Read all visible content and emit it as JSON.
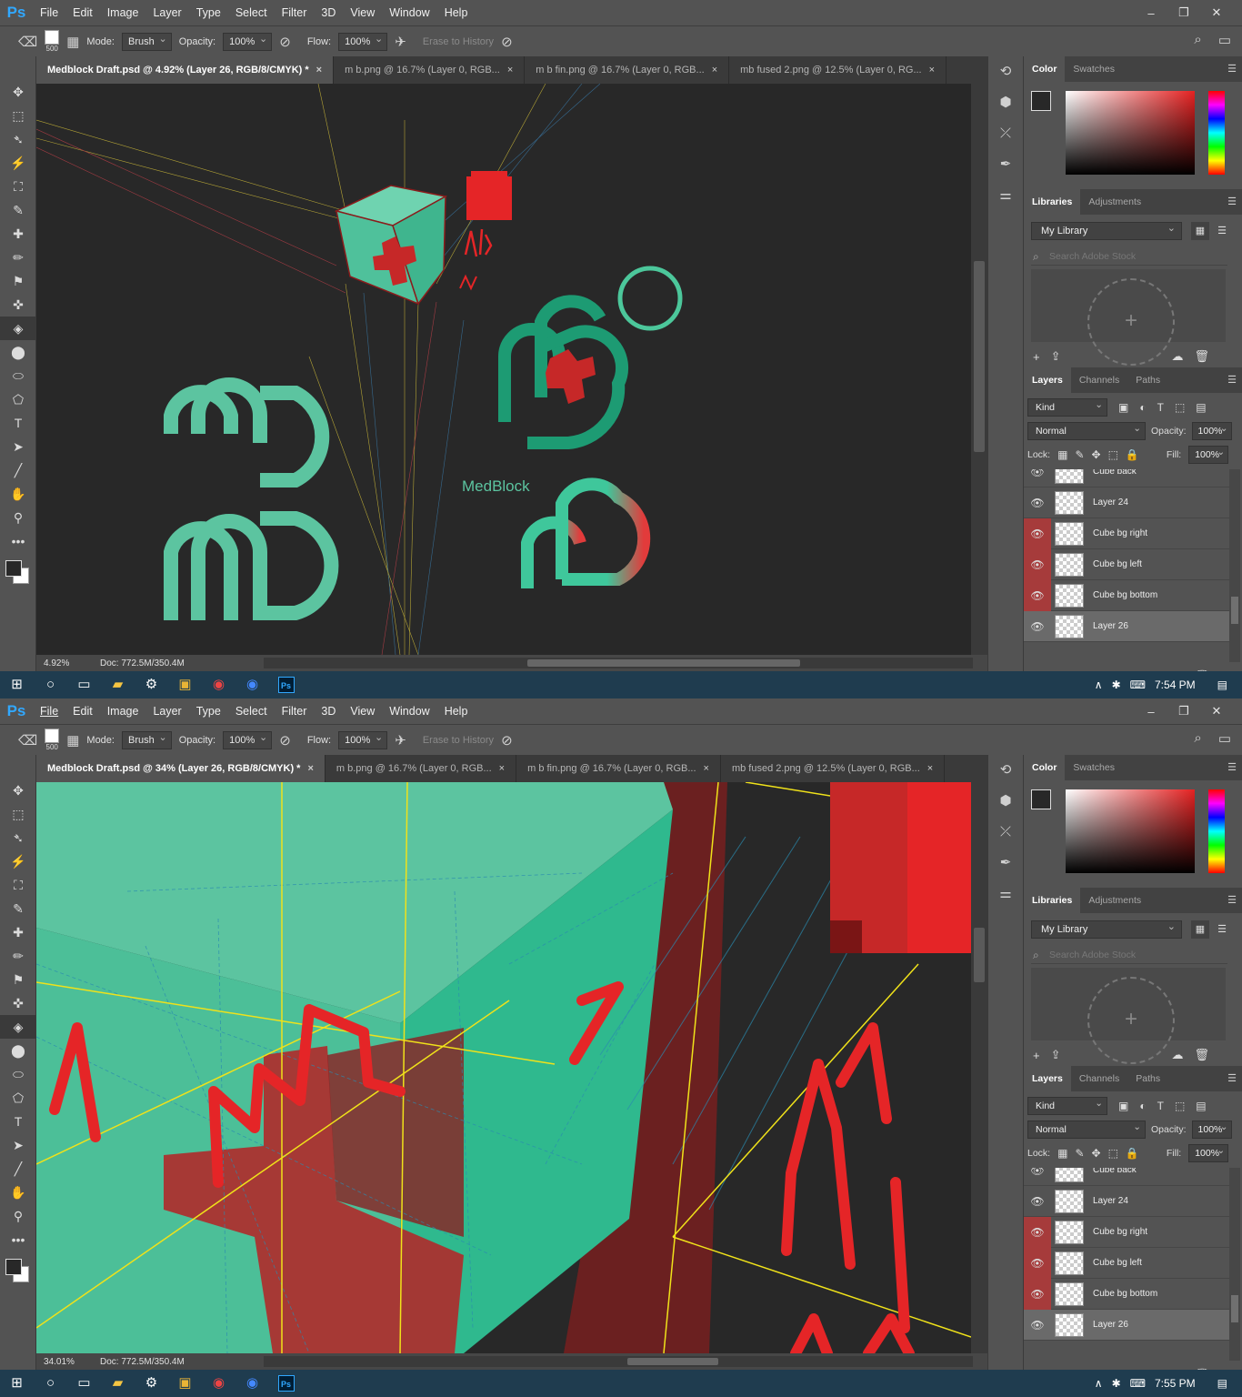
{
  "app": {
    "logo": "Ps"
  },
  "menu": [
    "File",
    "Edit",
    "Image",
    "Layer",
    "Type",
    "Select",
    "Filter",
    "3D",
    "View",
    "Window",
    "Help"
  ],
  "window_controls": [
    "–",
    "❐",
    "✕"
  ],
  "options": {
    "brush_size": "500",
    "mode_label": "Mode:",
    "mode_value": "Brush",
    "opacity_label": "Opacity:",
    "opacity_value": "100%",
    "flow_label": "Flow:",
    "flow_value": "100%",
    "erase_history": "Erase to History"
  },
  "tools": [
    "✥",
    "⬚",
    "➴",
    "⚡",
    "⛶",
    "✎",
    "✚",
    "✏",
    "⚑",
    "✜",
    "◈",
    "⬤",
    "⬭",
    "⬠",
    "T",
    "➤",
    "╱",
    "✋",
    "⚲",
    "•••"
  ],
  "screens": [
    {
      "tabs": [
        "Medblock Draft.psd @ 4.92% (Layer 26, RGB/8/CMYK) *",
        "m b.png @ 16.7% (Layer 0, RGB...",
        "m b fin.png @ 16.7% (Layer 0, RGB...",
        "mb fused 2.png @ 12.5% (Layer 0, RG..."
      ],
      "zoom": "4.92%",
      "doc": "Doc: 772.5M/350.4M",
      "clock": "7:54 PM",
      "canvas_logo": "MedBlock"
    },
    {
      "tabs": [
        "Medblock Draft.psd @ 34% (Layer 26, RGB/8/CMYK) *",
        "m b.png @ 16.7% (Layer 0, RGB...",
        "m b fin.png @ 16.7% (Layer 0, RGB...",
        "mb fused 2.png @ 12.5% (Layer 0, RGB..."
      ],
      "zoom": "34.01%",
      "doc": "Doc: 772.5M/350.4M",
      "clock": "7:55 PM"
    }
  ],
  "panels": {
    "color_tabs": [
      "Color",
      "Swatches"
    ],
    "library_tabs": [
      "Libraries",
      "Adjustments"
    ],
    "library_name": "My Library",
    "library_search": "Search Adobe Stock",
    "layer_tabs": [
      "Layers",
      "Channels",
      "Paths"
    ],
    "kind": "Kind",
    "blend": "Normal",
    "opacity_label": "Opacity:",
    "opacity": "100%",
    "lock_label": "Lock:",
    "fill_label": "Fill:",
    "fill": "100%",
    "layers": [
      {
        "name": "Cube back",
        "eye_red": false
      },
      {
        "name": "Layer 24",
        "eye_red": false
      },
      {
        "name": "Cube bg right",
        "eye_red": true
      },
      {
        "name": "Cube bg left",
        "eye_red": true
      },
      {
        "name": "Cube bg bottom",
        "eye_red": true
      },
      {
        "name": "Layer 26",
        "eye_red": false,
        "selected": true
      }
    ]
  },
  "colors": {
    "teal": "#5cc4a0",
    "dark_teal": "#1d9b73",
    "red": "#e52527",
    "canvas": "#282828"
  }
}
